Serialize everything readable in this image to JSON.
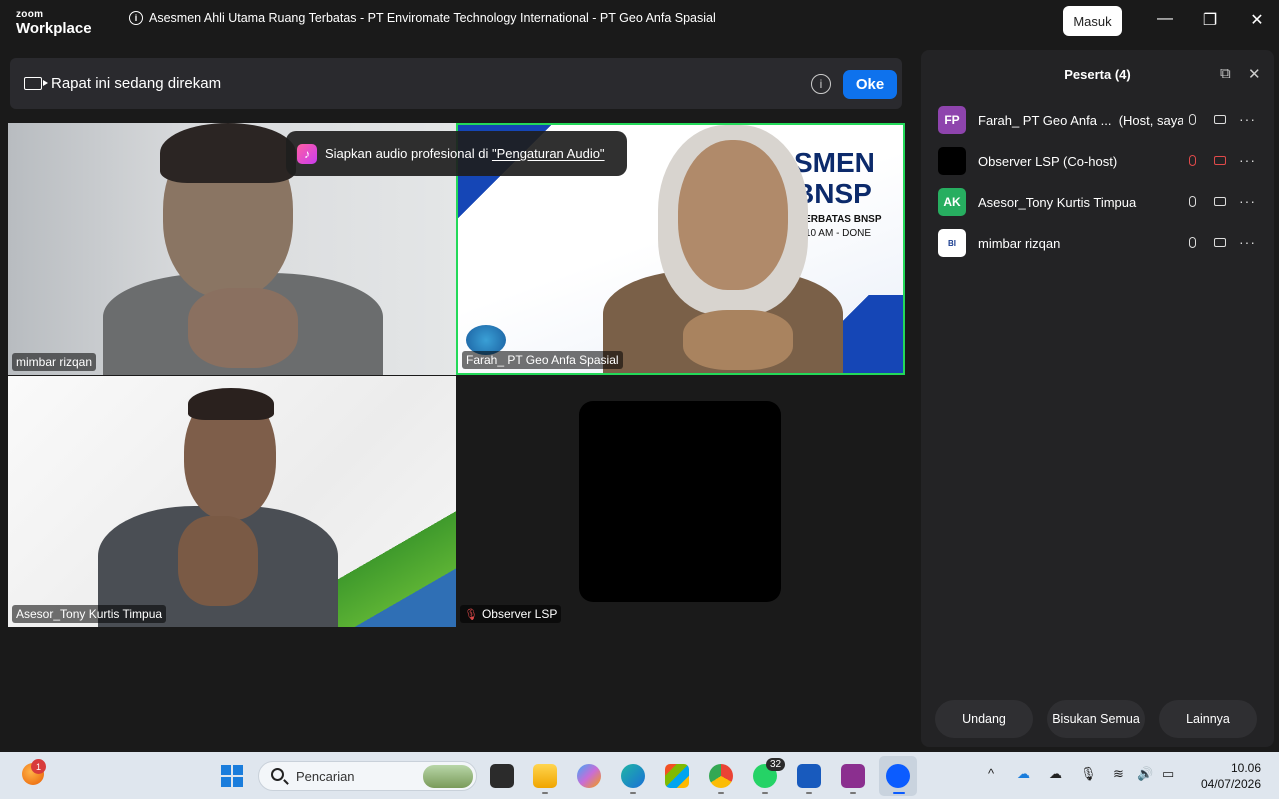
{
  "app": {
    "brand_top": "zoom",
    "brand_bottom": "Workplace",
    "meeting_title": "Asesmen Ahli Utama Ruang Terbatas - PT Enviromate Technology International - PT Geo Anfa Spasial",
    "signin_label": "Masuk"
  },
  "recording_banner": {
    "text": "Rapat ini sedang direkam",
    "ok_label": "Oke"
  },
  "audio_toast": {
    "prefix": "Siapkan audio profesional di ",
    "link": "\"Pengaturan Audio\""
  },
  "tiles": [
    {
      "name": "mimbar rizqan"
    },
    {
      "name": "Farah_ PT Geo Anfa Spasial",
      "slide_lines": [
        "SMEN",
        "BNSP",
        "TERBATAS BNSP",
        "6 |10  AM - DONE"
      ]
    },
    {
      "name": "Asesor_Tony Kurtis Timpua"
    },
    {
      "name": "Observer LSP"
    }
  ],
  "participants_panel": {
    "title": "Peserta (4)",
    "participants": [
      {
        "initials": "FP",
        "name": "Farah_ PT Geo Anfa ...",
        "role": "(Host, saya)",
        "avatar_color": "#8e44ad",
        "muted": false
      },
      {
        "initials": "",
        "name": "Observer LSP (Co-host)",
        "role": "",
        "avatar_color": "#000000",
        "muted": true
      },
      {
        "initials": "AK",
        "name": "Asesor_Tony Kurtis Timpua",
        "role": "",
        "avatar_color": "#27ae60",
        "muted": false
      },
      {
        "initials": "BI",
        "name": "mimbar rizqan",
        "role": "",
        "avatar_color": "#ffffff",
        "muted": false
      }
    ],
    "buttons": {
      "invite": "Undang",
      "mute_all": "Bisukan Semua",
      "more": "Lainnya"
    }
  },
  "taskbar": {
    "notification_count": "1",
    "search_placeholder": "Pencarian",
    "whatsapp_badge": "32",
    "time": "10.06",
    "date": "04/07/2026"
  }
}
